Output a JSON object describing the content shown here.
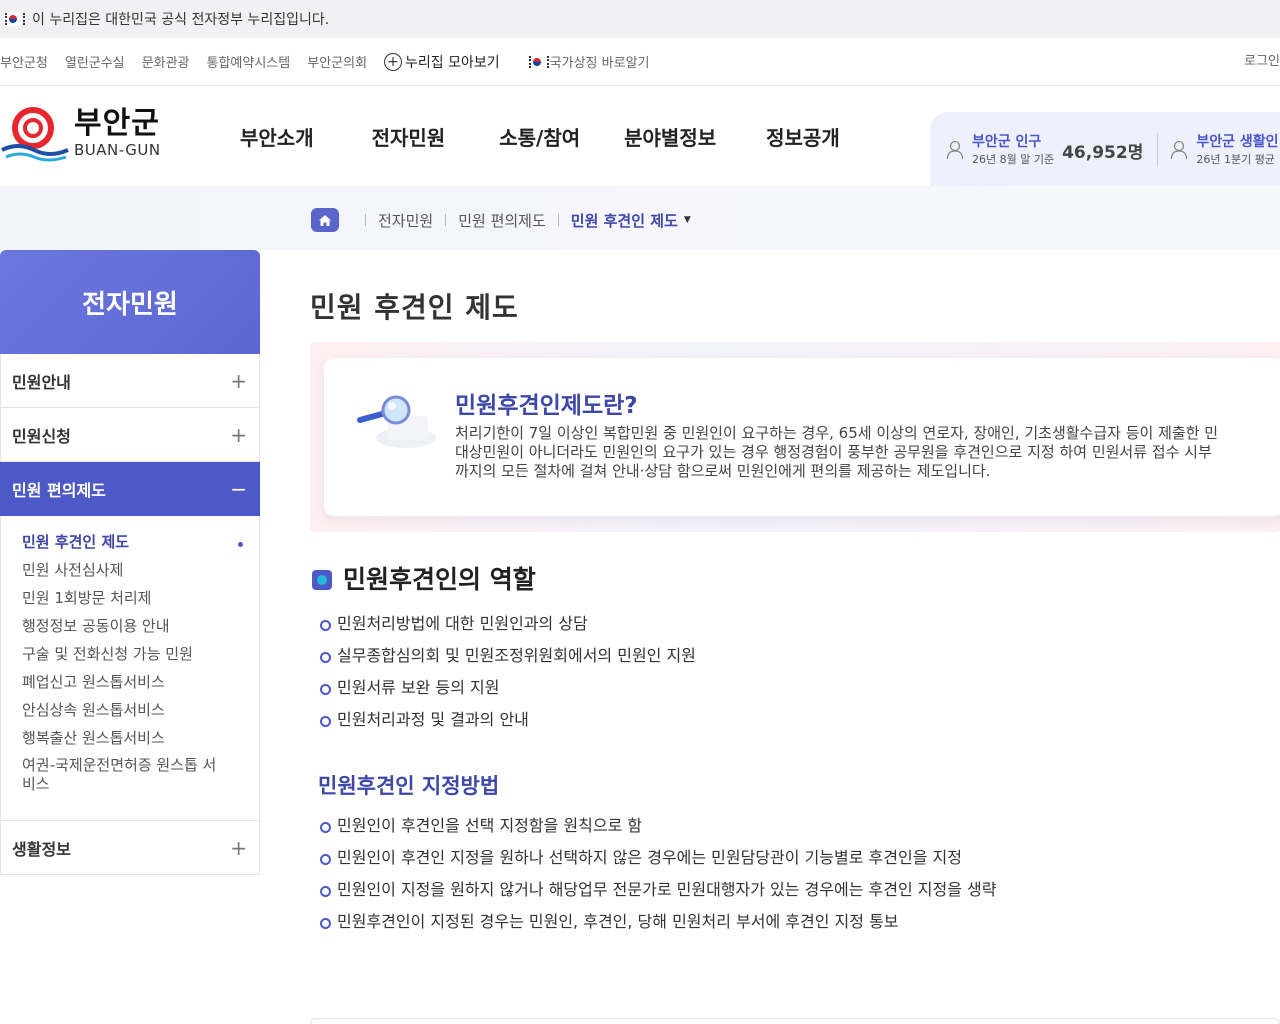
{
  "gov_banner": {
    "text": "이 누리집은 대한민국 공식 전자정부 누리집입니다."
  },
  "util_links": [
    "부안군청",
    "열린군수실",
    "문화관광",
    "통합예약시스템",
    "부안군의회"
  ],
  "nuri_link": "누리집 모아보기",
  "symbol_link": "국가상징 바로알기",
  "login": "로그인",
  "logo": {
    "ko": "부안군",
    "en": "BUAN-GUN"
  },
  "gnb": [
    "부안소개",
    "전자민원",
    "소통/참여",
    "분야별정보",
    "정보공개"
  ],
  "stats": {
    "population": {
      "label": "부안군 인구",
      "sub": "26년 8월 말 기준",
      "value": "46,952명"
    },
    "living": {
      "label": "부안군 생활인",
      "sub": "26년 1분기 평균"
    }
  },
  "breadcrumb": [
    "전자민원",
    "민원 편의제도",
    "민원 후견인 제도"
  ],
  "sidebar": {
    "title": "전자민원",
    "items": [
      {
        "label": "민원안내",
        "toggle": "+"
      },
      {
        "label": "민원신청",
        "toggle": "+"
      },
      {
        "label": "민원 편의제도",
        "toggle": "−"
      }
    ],
    "sub_items": [
      "민원 후견인 제도",
      "민원 사전심사제",
      "민원 1회방문 처리제",
      "행정정보 공동이용 안내",
      "구술 및 전화신청 가능 민원",
      "폐업신고 원스톱서비스",
      "안심상속 원스톱서비스",
      "행복출산 원스톱서비스",
      "여권-국제운전면허증 원스톱 서비스"
    ],
    "last_item": {
      "label": "생활정보",
      "toggle": "+"
    }
  },
  "page_title": "민원 후견인 제도",
  "intro": {
    "heading": "민원후견인제도란?",
    "lines": [
      "처리기한이 7일 이상인 복합민원 중 민원인이 요구하는 경우, 65세 이상의 연로자, 장애인, 기초생활수급자 등이 제출한 민",
      "대상민원이 아니더라도 민원인의 요구가 있는 경우 행정경험이 풍부한 공무원을 후견인으로  지정 하여 민원서류 접수 시부",
      "까지의 모든 절차에 걸쳐 안내·상담 함으로써 민원인에게 편의를 제공하는 제도입니다."
    ]
  },
  "roles": {
    "title": "민원후견인의 역할",
    "items": [
      "민원처리방법에 대한 민원인과의 상담",
      "실무종합심의회 및 민원조정위원회에서의 민원인 지원",
      "민원서류 보완 등의 지원",
      "민원처리과정 및 결과의 안내"
    ]
  },
  "method": {
    "title": "민원후견인 지정방법",
    "items": [
      "민원인이 후견인을 선택 지정함을 원칙으로 함",
      "민원인이 후견인 지정을 원하나 선택하지 않은 경우에는 민원담당관이 기능별로 후견인을 지정",
      "민원인이 지정을 원하지 않거나 해당업무 전문가로 민원대행자가 있는 경우에는 후견인 지정을 생략",
      "민원후견인이 지정된 경우는 민원인, 후견인, 당해 민원처리 부서에 후견인 지정 통보"
    ]
  },
  "colors": {
    "accent": "#4d59c6",
    "title_blue": "#3d47a8",
    "sidebar_head": "#6b76de"
  }
}
